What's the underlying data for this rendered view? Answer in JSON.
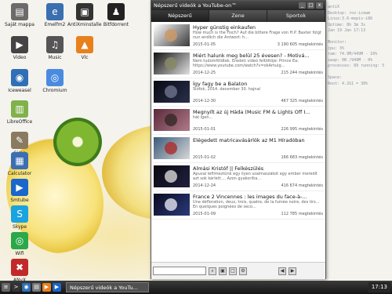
{
  "desktop": {
    "icons": [
      {
        "label": "Saját mappa",
        "icon": "folder-icon",
        "color": "#6b6b6b",
        "glyph": "▤"
      },
      {
        "label": "Emelfm2",
        "icon": "file-manager-icon",
        "color": "#3a6fb0",
        "glyph": "e"
      },
      {
        "label": "AntiXminstaller",
        "icon": "installer-icon",
        "color": "#333333",
        "glyph": "▣"
      },
      {
        "label": "Bitfdorrent",
        "icon": "bittorrent-icon",
        "color": "#222222",
        "glyph": "♟"
      },
      {
        "label": "Video",
        "icon": "video-icon",
        "color": "#444444",
        "glyph": "▶"
      },
      {
        "label": "Music",
        "icon": "music-icon",
        "color": "#555555",
        "glyph": "♫"
      },
      {
        "label": "Vlc",
        "icon": "vlc-icon",
        "color": "#e8801c",
        "glyph": "▲"
      },
      {
        "label": "Iceweasel",
        "icon": "iceweasel-icon",
        "color": "#2f6fb6",
        "glyph": "◉"
      },
      {
        "label": "Chromium",
        "icon": "chromium-icon",
        "color": "#4a8be0",
        "glyph": "◎"
      },
      {
        "label": "LibreOffice",
        "icon": "libreoffice-icon",
        "color": "#7fb24a",
        "glyph": "▥"
      },
      {
        "label": "Gimp",
        "icon": "gimp-icon",
        "color": "#8a7b60",
        "glyph": "✎"
      },
      {
        "label": "Calculator",
        "icon": "calculator-icon",
        "color": "#3b6fb3",
        "glyph": "▦"
      },
      {
        "label": "Smtube",
        "icon": "smtube-icon",
        "color": "#1a66cc",
        "glyph": "▶"
      },
      {
        "label": "Skype",
        "icon": "skype-icon",
        "color": "#19a3e0",
        "glyph": "S"
      },
      {
        "label": "Wifi",
        "icon": "wifi-icon",
        "color": "#2aa84a",
        "glyph": "◎"
      },
      {
        "label": "ANyX",
        "icon": "anyx-icon",
        "color": "#c02a2a",
        "glyph": "✖"
      }
    ]
  },
  "conky": {
    "lines": [
      "antiX",
      "Desktop: rox-icewm",
      "Linux:3.6-mepis-i86",
      "Uptime: 8h 3m 3s",
      "Jan 19 Jan 17:13",
      "",
      "Monitor:",
      "cpu: 3%",
      "ram: 74.9M/449M - 16%",
      "swap: 0B  /949M - 0%",
      "processes: 89   running: 5",
      "",
      "Space:",
      "Root: 4.2G1 = 38%"
    ]
  },
  "window": {
    "title": "Népszerű videók a YouTube-on™",
    "buttons": {
      "close": "x",
      "max": "□",
      "min": "_"
    },
    "tabs": [
      "Népszerű",
      "Zene",
      "Sportok"
    ],
    "active_tab": 0,
    "videos": [
      {
        "title": "Hyper günstig einkaufen",
        "desc": "How much is the Fisch? Auf die bittere Frage von H.P. Baxter folgt nun endlich die Antwort: h...",
        "date": "2015-01-05",
        "views": "3 190 605 megtekintés",
        "colors": [
          "#ffffff",
          "#3a3a3a",
          "#cc9966"
        ]
      },
      {
        "title": "Miért halunk meg belül 25 évesen? - Motivá...",
        "desc": "Nem tudomföldtek. Eredeti videó feltöltője: Prince Ea: https://www.youtube.com/watch?v=okAmuig...",
        "date": "2014-12-25",
        "views": "215 244 megtekintés",
        "colors": [
          "#111111",
          "#e0e0e0",
          "#888866"
        ]
      },
      {
        "title": "Így fagy be a Balaton",
        "desc": "Siófok, 2014. december 30. hajnal",
        "date": "2014-12-30",
        "views": "467 325 megtekintés",
        "colors": [
          "#0a0a14",
          "#2a2f4a",
          "#6a6f88"
        ]
      },
      {
        "title": "Megnyílt az új Háda (Music FM & Lights Off I...",
        "desc": "hát igen...",
        "date": "2015-01-01",
        "views": "226 995 megtekintés",
        "colors": [
          "#5a2a3a",
          "#b07a8a",
          "#3a2a2a"
        ]
      },
      {
        "title": "Elégedett matricavásárlók az M1 Híradóban",
        "desc": "",
        "date": "2015-01-02",
        "views": "166 683 megtekintés",
        "colors": [
          "#3a5a7a",
          "#d8d8d8",
          "#aa3333"
        ]
      },
      {
        "title": "Almási Kristóf || Felkészülés",
        "desc": "Apuval lefilmeztünk egy ilyen szalmaszákot egy ember meredít azt sok kérlett.... Azon gyakorlita...",
        "date": "2014-12-24",
        "views": "416 674 megtekintés",
        "colors": [
          "#0a0a10",
          "#202040",
          "#cccccc"
        ]
      },
      {
        "title": "France 2 Vincennes : les images du face-à-...",
        "desc": "Une défloration, deux, trois, quatre, de la fumée noire, des tirs... En quelques poignées de seco...",
        "date": "2015-01-09",
        "views": "112 785 megtekintés",
        "colors": [
          "#0a0a20",
          "#2a3a7a",
          "#d8d8e8"
        ]
      }
    ],
    "search": {
      "value": "",
      "placeholder": ""
    },
    "toolbar_icons": [
      "search-icon",
      "home-icon",
      "stop-icon",
      "settings-icon",
      "prev-icon",
      "next-icon"
    ],
    "toolbar_glyphs": [
      "⌕",
      "▣",
      "□",
      "⚙",
      "◀",
      "▶"
    ]
  },
  "taskbar": {
    "quick": [
      {
        "icon": "menu-icon",
        "glyph": "≡",
        "color": "#666666"
      },
      {
        "icon": "terminal-icon",
        "glyph": ">",
        "color": "#333333"
      },
      {
        "icon": "browser-icon",
        "glyph": "◉",
        "color": "#2f6fb6"
      },
      {
        "icon": "files-icon",
        "glyph": "▤",
        "color": "#777777"
      },
      {
        "icon": "media-icon",
        "glyph": "▶",
        "color": "#e8801c"
      },
      {
        "icon": "tube-icon",
        "glyph": "▶",
        "color": "#1a66cc"
      }
    ],
    "task_title": "Népszerű videók a YouTu...",
    "clock": "17:13"
  }
}
